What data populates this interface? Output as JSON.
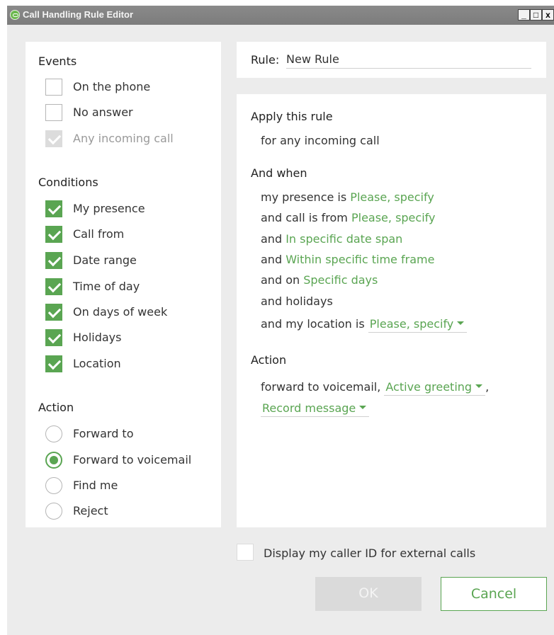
{
  "window": {
    "title": "Call Handling Rule Editor",
    "controls": {
      "minimize": "_",
      "maximize": "□",
      "close": "x"
    }
  },
  "events": {
    "title": "Events",
    "items": [
      {
        "label": "On the phone",
        "checked": false,
        "disabled": false
      },
      {
        "label": "No answer",
        "checked": false,
        "disabled": false
      },
      {
        "label": "Any incoming call",
        "checked": true,
        "disabled": true
      }
    ]
  },
  "conditions": {
    "title": "Conditions",
    "items": [
      {
        "label": "My presence",
        "checked": true
      },
      {
        "label": "Call from",
        "checked": true
      },
      {
        "label": "Date range",
        "checked": true
      },
      {
        "label": "Time of day",
        "checked": true
      },
      {
        "label": "On days of week",
        "checked": true
      },
      {
        "label": "Holidays",
        "checked": true
      },
      {
        "label": "Location",
        "checked": true
      }
    ]
  },
  "action_options": {
    "title": "Action",
    "items": [
      {
        "label": "Forward to",
        "selected": false
      },
      {
        "label": "Forward to voicemail",
        "selected": true
      },
      {
        "label": "Find me",
        "selected": false
      },
      {
        "label": "Reject",
        "selected": false
      }
    ]
  },
  "rule": {
    "label": "Rule:",
    "value": "New Rule"
  },
  "summary": {
    "apply_title": "Apply this rule",
    "apply_text": "for any incoming call",
    "and_when_title": "And when",
    "presence_prefix": "my presence is",
    "presence_link": "Please, specify",
    "callfrom_prefix": "and call is from",
    "callfrom_link": "Please, specify",
    "date_prefix": "and",
    "date_link": "In specific date span",
    "time_prefix": "and",
    "time_link": "Within specific time frame",
    "days_prefix": "and on",
    "days_link": "Specific days",
    "holidays_text": "and holidays",
    "location_prefix": "and my location is",
    "location_dropdown": "Please, specify",
    "action_title": "Action",
    "action_prefix": "forward to voicemail,",
    "greeting_dropdown": "Active greeting",
    "greeting_suffix": ",",
    "record_dropdown": "Record message"
  },
  "callerid": {
    "label": "Display my caller ID for external calls",
    "checked": false
  },
  "buttons": {
    "ok": "OK",
    "cancel": "Cancel"
  },
  "colors": {
    "accent": "#5aa552",
    "titlebar": "#808080",
    "background": "#ececec"
  }
}
